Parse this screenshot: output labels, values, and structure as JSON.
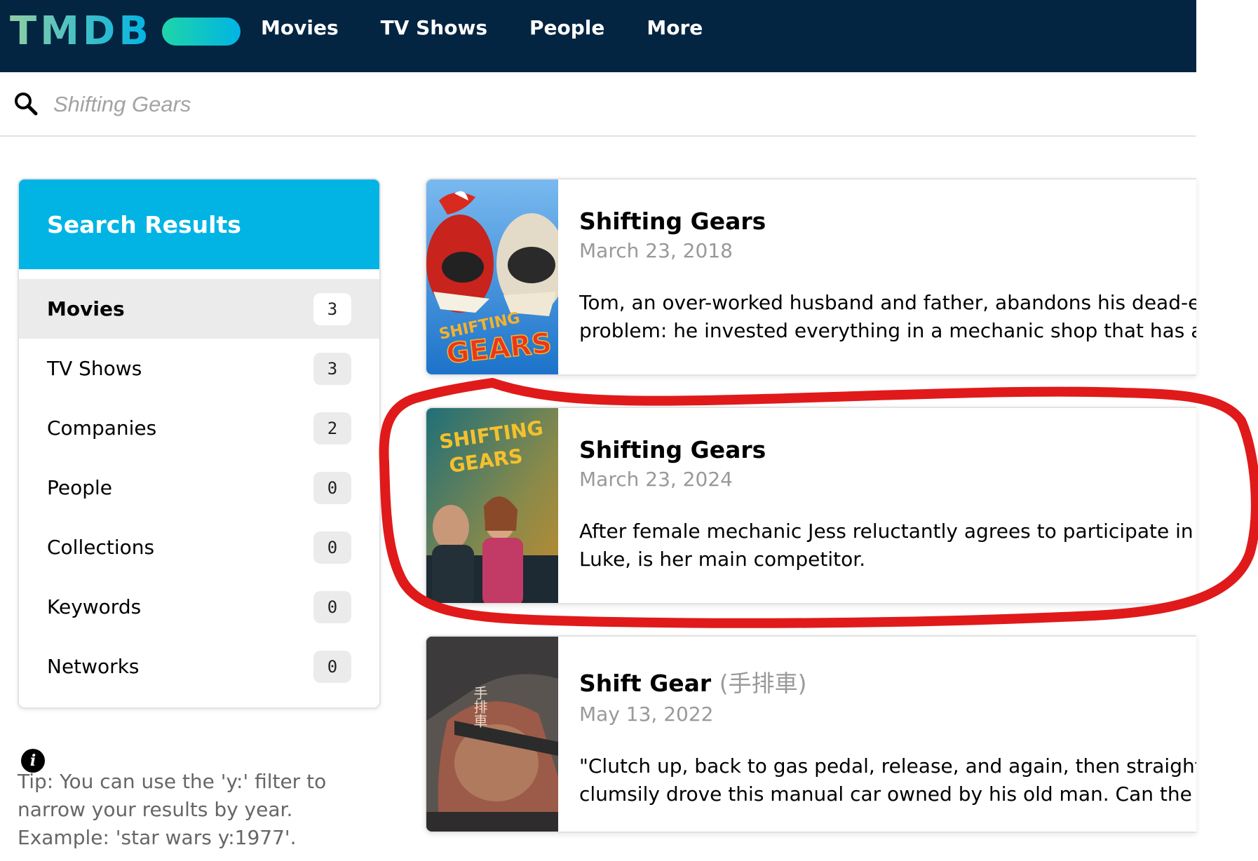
{
  "header": {
    "logo_text": "TMDB",
    "nav": [
      "Movies",
      "TV Shows",
      "People",
      "More"
    ]
  },
  "search": {
    "placeholder": "Shifting Gears"
  },
  "sidebar": {
    "title": "Search Results",
    "items": [
      {
        "label": "Movies",
        "count": "3",
        "active": true
      },
      {
        "label": "TV Shows",
        "count": "3"
      },
      {
        "label": "Companies",
        "count": "2"
      },
      {
        "label": "People",
        "count": "0"
      },
      {
        "label": "Collections",
        "count": "0"
      },
      {
        "label": "Keywords",
        "count": "0"
      },
      {
        "label": "Networks",
        "count": "0"
      }
    ]
  },
  "tip": {
    "icon": "info-icon",
    "text": "Tip: You can use the 'y:' filter to narrow your results by year. Example: 'star wars y:1977'."
  },
  "results": [
    {
      "title": "Shifting Gears",
      "original_title": "",
      "date": "March 23, 2018",
      "overview_line1": "Tom, an over-worked husband and father, abandons his dead-end j",
      "overview_line2": "problem: he invested everything in a mechanic shop that has a lien",
      "poster_text_1": "SHIFTING",
      "poster_text_2": "GEARS"
    },
    {
      "title": "Shifting Gears",
      "original_title": "",
      "date": "March 23, 2024",
      "overview_line1": "After female mechanic Jess reluctantly agrees to participate in a ca",
      "overview_line2": "Luke, is her main competitor.",
      "poster_text_1": "SHIFTING",
      "poster_text_2": "GEARS"
    },
    {
      "title": "Shift Gear",
      "original_title": "(手排車)",
      "date": "May 13, 2022",
      "overview_line1": "\"Clutch up, back to gas pedal, release, and again, then straighten th",
      "overview_line2": "clumsily drove this manual car owned by his old man. Can the fathe",
      "poster_text_1": "手排車"
    }
  ],
  "colors": {
    "header_bg": "#032541",
    "accent": "#01b4e4",
    "highlight": "#e01a1a"
  }
}
